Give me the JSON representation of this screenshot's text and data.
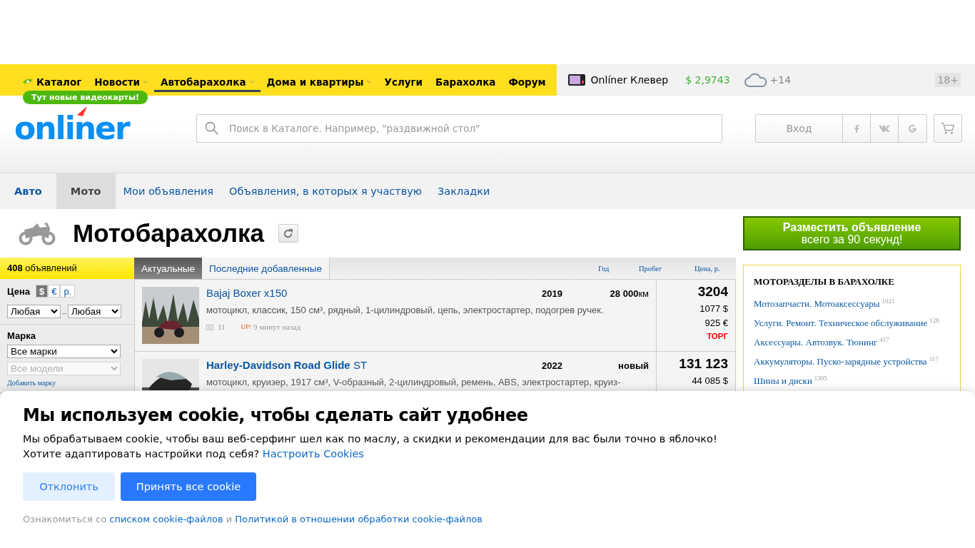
{
  "top_nav": {
    "items": [
      {
        "label": "Каталог",
        "selected": false,
        "dropdown": false,
        "kind": "catalog"
      },
      {
        "label": "Новости",
        "selected": false,
        "dropdown": true,
        "kind": "link"
      },
      {
        "label": "Автобарахолка",
        "selected": true,
        "dropdown": true,
        "kind": "link"
      },
      {
        "label": "Дома и квартиры",
        "selected": false,
        "dropdown": true,
        "kind": "link"
      },
      {
        "label": "Услуги",
        "selected": false,
        "dropdown": false,
        "kind": "link"
      },
      {
        "label": "Барахолка",
        "selected": false,
        "dropdown": false,
        "kind": "link"
      },
      {
        "label": "Форум",
        "selected": false,
        "dropdown": false,
        "kind": "link"
      }
    ],
    "badge": "Тут новые видеокарты!",
    "clever": "Onlíner Клевер",
    "rate": "$ 2,9743",
    "temperature": "+14",
    "age": "18+"
  },
  "header": {
    "logo": "onliner",
    "search_placeholder": "Поиск в Каталоге. Например, \"раздвижной стол\"",
    "login": "Вход"
  },
  "subnav": [
    {
      "label": "Авто",
      "selected": false,
      "kind": "section"
    },
    {
      "label": "Мото",
      "selected": true,
      "kind": "section"
    },
    {
      "label": "Мои объявления",
      "selected": false,
      "kind": "link"
    },
    {
      "label": "Объявления, в которых я участвую",
      "selected": false,
      "kind": "link"
    },
    {
      "label": "Закладки",
      "selected": false,
      "kind": "link"
    }
  ],
  "page_title": "Мотобарахолка",
  "filters": {
    "count": "408",
    "count_label": "объявлений",
    "price_label": "Цена",
    "currencies": [
      {
        "label": "$",
        "selected": true
      },
      {
        "label": "€",
        "selected": false
      },
      {
        "label": "р.",
        "selected": false
      }
    ],
    "price_from": "Любая",
    "price_to": "Любая",
    "brand_label": "Марка",
    "brand": "Все марки",
    "model": "Все модели",
    "model_disabled": true,
    "add_brand": "Добавить марку"
  },
  "list_tabs": [
    {
      "label": "Актуальные",
      "selected": true
    },
    {
      "label": "Последние добавленные",
      "selected": false
    }
  ],
  "columns": [
    "Год",
    "Пробег",
    "Цена, р."
  ],
  "listings": [
    {
      "title": "Bajaj Boxer x150",
      "description": "мотоцикл, классик, 150 см³, рядный, 1-цилиндровый, цепь, электростартер, подогрев ручек.",
      "year": "2019",
      "mileage": "28 000",
      "mileage_unit": "км",
      "price": "3204",
      "price_usd": "1077 $",
      "price_eur": "925 €",
      "bargain": "ТОРГ",
      "photos": "11",
      "up": "UP!",
      "time": "9 минут назад"
    },
    {
      "title": "**Harley-Davidson Road Glide** ST",
      "description": "мотоцикл, круизер, 1917 см³, V-образный, 2-цилиндровый, ремень, ABS, электростартер, круиз-",
      "year": "2022",
      "mileage": "новый",
      "price": "131 123",
      "price_usd": "44 085 $"
    }
  ],
  "sidebar": {
    "post_title": "Разместить объявление",
    "post_subtitle": "всего за 90 секунд!",
    "heading": "МОТОРАЗДЕЛЫ В БАРАХОЛКЕ",
    "links": [
      {
        "label": "Мотозапчасти. Мотоаксессуары",
        "count": "1021"
      },
      {
        "label": "Услуги. Ремонт. Техническое обслуживание",
        "count": "128"
      },
      {
        "label": "Аксессуары. Автозвук. Тюнинг",
        "count": "417"
      },
      {
        "label": "Аккумуляторы. Пуско-зарядные устройства",
        "count": "117"
      },
      {
        "label": "Шины и диски",
        "count": "1305"
      }
    ]
  },
  "cookie": {
    "title": "Мы используем cookie, чтобы сделать сайт удобнее",
    "text": "Мы обрабатываем cookie, чтобы ваш веб-серфинг шел как по маслу, а скидки и рекомендации для вас были точно в яблочко!",
    "question": "Хотите адаптировать настройки под себя?",
    "settings_link": "Настроить Cookies",
    "decline": "Отклонить",
    "accept": "Принять все cookie",
    "footer_prefix": "Ознакомиться со",
    "footer_link1": "списком cookie-файлов",
    "footer_and": "и",
    "footer_link2": "Политикой в отношении обработки cookie-файлов"
  }
}
